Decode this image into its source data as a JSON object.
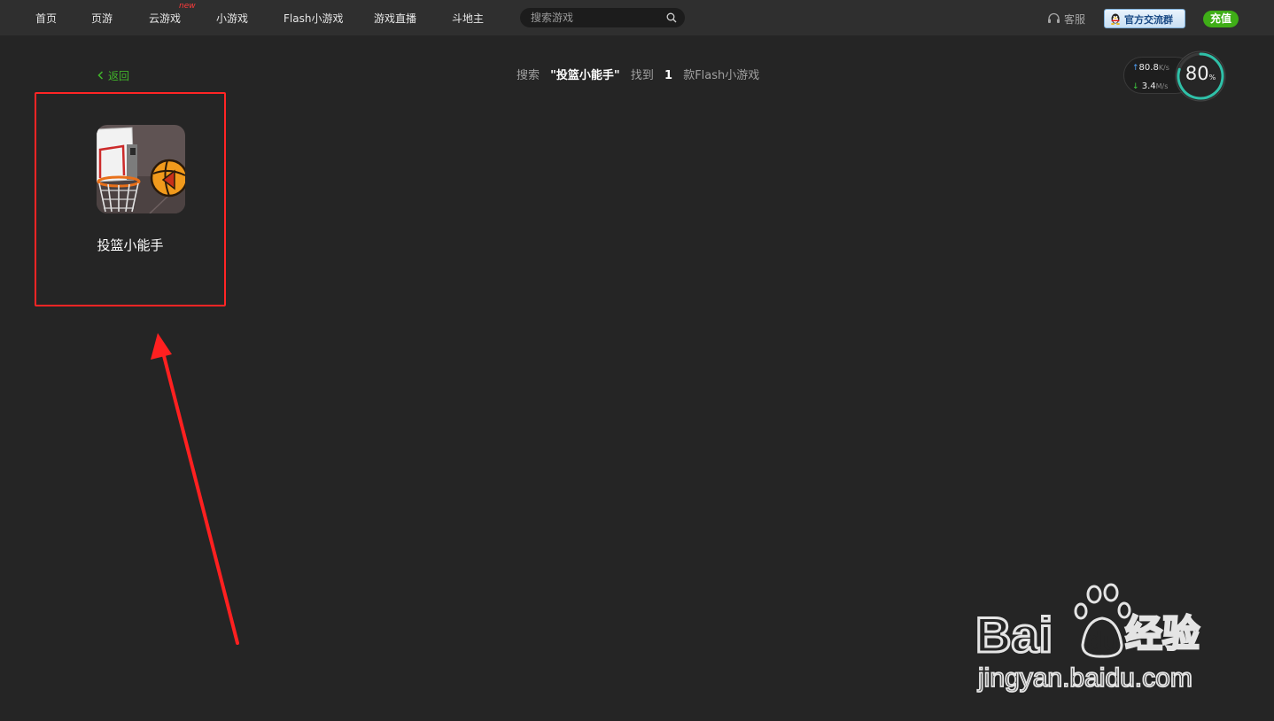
{
  "nav": {
    "items": [
      {
        "label": "首页"
      },
      {
        "label": "页游"
      },
      {
        "label": "云游戏",
        "badge": "new"
      },
      {
        "label": "小游戏"
      },
      {
        "label": "Flash小游戏"
      },
      {
        "label": "游戏直播"
      },
      {
        "label": "斗地主"
      }
    ],
    "search_placeholder": "搜索游戏",
    "search_icon": "search-icon",
    "service_label": "客服",
    "service_icon": "headset-icon",
    "qq_group_label": "官方交流群",
    "qq_icon": "qq-penguin-icon",
    "recharge_label": "充值"
  },
  "content": {
    "back_label": "返回",
    "result": {
      "prefix": "搜索",
      "keyword": "\"投篮小能手\"",
      "found_label": "找到",
      "count": "1",
      "suffix": "款Flash小游戏"
    },
    "games": [
      {
        "title": "投篮小能手",
        "thumbnail": "basketball-hoop-thumbnail"
      }
    ]
  },
  "speed_widget": {
    "upload": "80.8",
    "upload_unit": "K/s",
    "download": "3.4",
    "download_unit": "M/s",
    "percent": "80",
    "percent_unit": "%"
  },
  "colors": {
    "background": "#252525",
    "topbar": "#2f2f2f",
    "accent_green": "#41b62a",
    "annotation_red": "#ff2525"
  },
  "watermark": {
    "brand_left": "Bai",
    "brand_right": "经验",
    "url": "jingyan.baidu.com"
  }
}
